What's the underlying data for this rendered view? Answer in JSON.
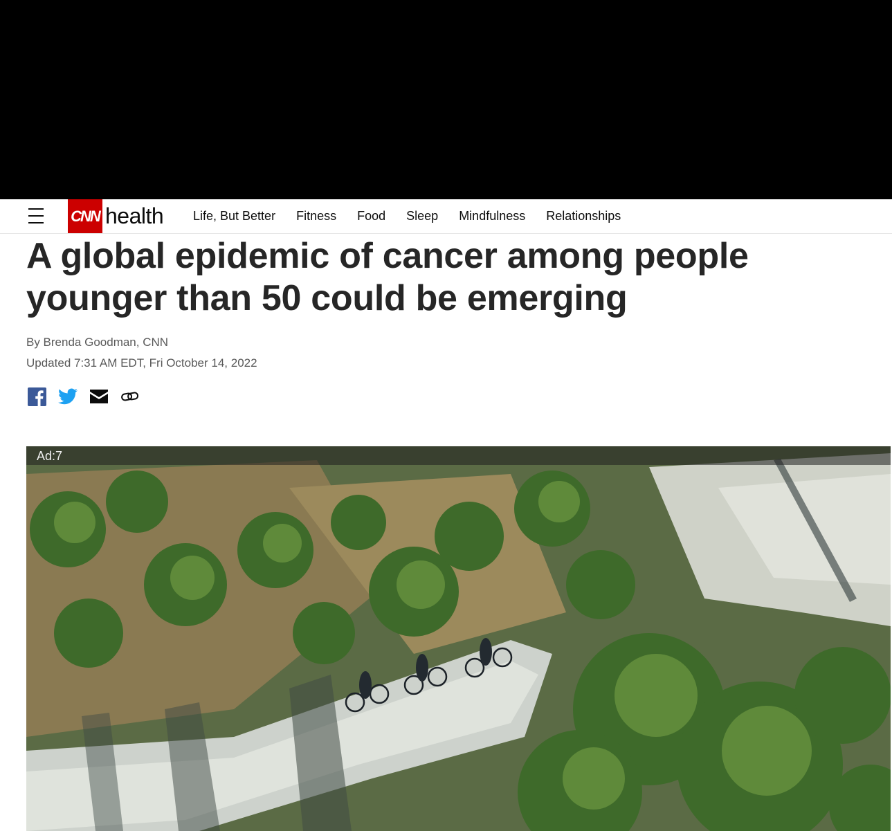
{
  "nav": {
    "logo_brand": "CNN",
    "logo_section": "health",
    "links": [
      "Life, But Better",
      "Fitness",
      "Food",
      "Sleep",
      "Mindfulness",
      "Relationships"
    ]
  },
  "article": {
    "headline": "A global epidemic of cancer among people younger than 50 could be emerging",
    "byline": "By Brenda Goodman, CNN",
    "updated": "Updated 7:31 AM EDT, Fri October 14, 2022"
  },
  "share": {
    "icons": [
      "facebook-icon",
      "twitter-icon",
      "email-icon",
      "link-icon"
    ]
  },
  "video": {
    "ad_label": "Ad:7"
  },
  "colors": {
    "brand_red": "#cc0000",
    "facebook_blue": "#3b5998",
    "twitter_blue": "#1da1f2"
  }
}
